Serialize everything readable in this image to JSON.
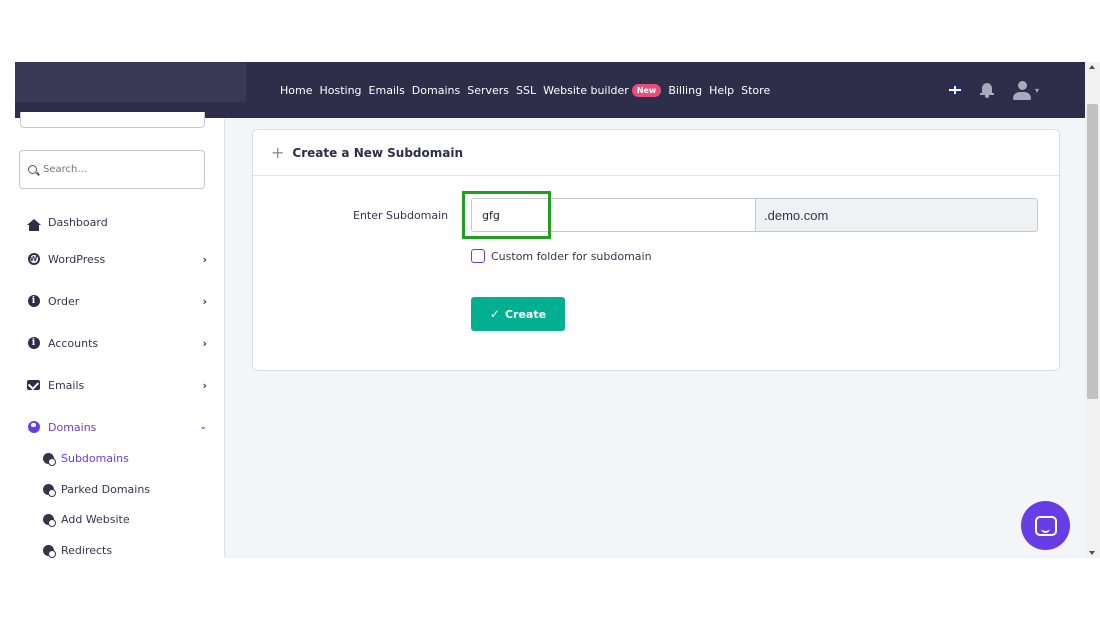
{
  "nav": {
    "items": [
      {
        "label": "Home"
      },
      {
        "label": "Hosting"
      },
      {
        "label": "Emails"
      },
      {
        "label": "Domains"
      },
      {
        "label": "Servers"
      },
      {
        "label": "SSL"
      },
      {
        "label": "Website builder"
      },
      {
        "label": "Billing"
      },
      {
        "label": "Help"
      },
      {
        "label": "Store"
      }
    ],
    "new_badge": "New",
    "icons": [
      "uk-flag-icon",
      "bell-icon",
      "user-icon",
      "chevron-down-icon"
    ]
  },
  "sidebar": {
    "search_placeholder": "Search...",
    "items": [
      {
        "label": "Dashboard",
        "icon": "home-icon"
      },
      {
        "label": "WordPress",
        "icon": "wordpress-icon",
        "chevron": "›"
      },
      {
        "label": "Order",
        "icon": "info-icon",
        "chevron": "›"
      },
      {
        "label": "Accounts",
        "icon": "info-icon",
        "chevron": "›"
      },
      {
        "label": "Emails",
        "icon": "envelope-icon",
        "chevron": "›"
      },
      {
        "label": "Domains",
        "icon": "globe-icon",
        "chevron": "⌄"
      }
    ],
    "subitems": [
      {
        "label": "Subdomains"
      },
      {
        "label": "Parked Domains"
      },
      {
        "label": "Add Website"
      },
      {
        "label": "Redirects"
      }
    ]
  },
  "card": {
    "title": "Create a New Subdomain",
    "field_label": "Enter Subdomain",
    "field_value": "gfg",
    "suffix": ".demo.com",
    "checkbox_label": "Custom folder for subdomain",
    "button_label": "Create"
  },
  "colors": {
    "topbar": "#2e2d4a",
    "accent": "#673de6",
    "button": "#00b090",
    "highlight": "#1fa01f"
  }
}
